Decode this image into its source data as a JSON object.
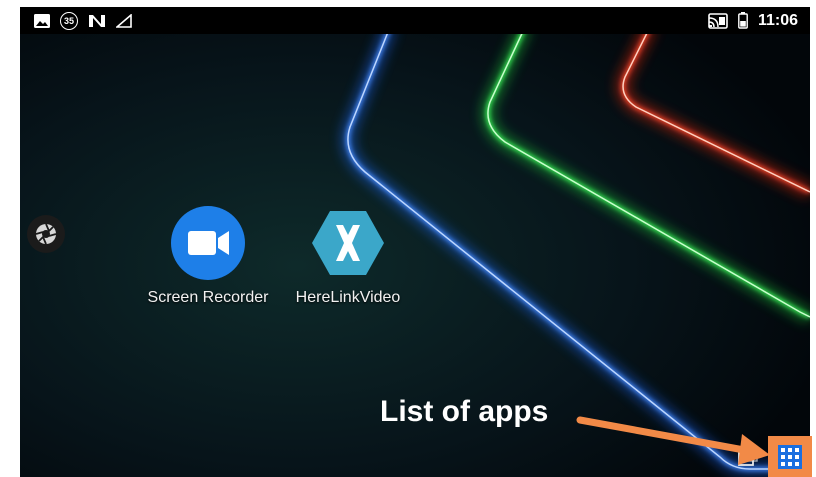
{
  "status_bar": {
    "left_icons": [
      "image-icon",
      "notification-35-icon",
      "n-icon",
      "signal-icon"
    ],
    "badge_number": "35",
    "right_icons": [
      "cast-icon",
      "battery-icon"
    ],
    "time": "11:06"
  },
  "apps": [
    {
      "label": "Screen Recorder",
      "icon": "video-camera-icon",
      "color": "#1e7fe8"
    },
    {
      "label": "HereLinkVideo",
      "icon": "xamarin-x-icon",
      "color": "#3ba7c9"
    }
  ],
  "side_button": {
    "icon": "shutter-icon"
  },
  "annotation": {
    "text": "List of apps",
    "arrow_color": "#f28a47"
  },
  "app_drawer_button": {
    "icon": "grid-icon",
    "highlight_color": "#f28a47"
  },
  "recent_button": {
    "icon": "recent-apps-icon"
  },
  "wallpaper": {
    "neon_colors": [
      "#1e6cff",
      "#1fd63a",
      "#ff2a10"
    ]
  }
}
